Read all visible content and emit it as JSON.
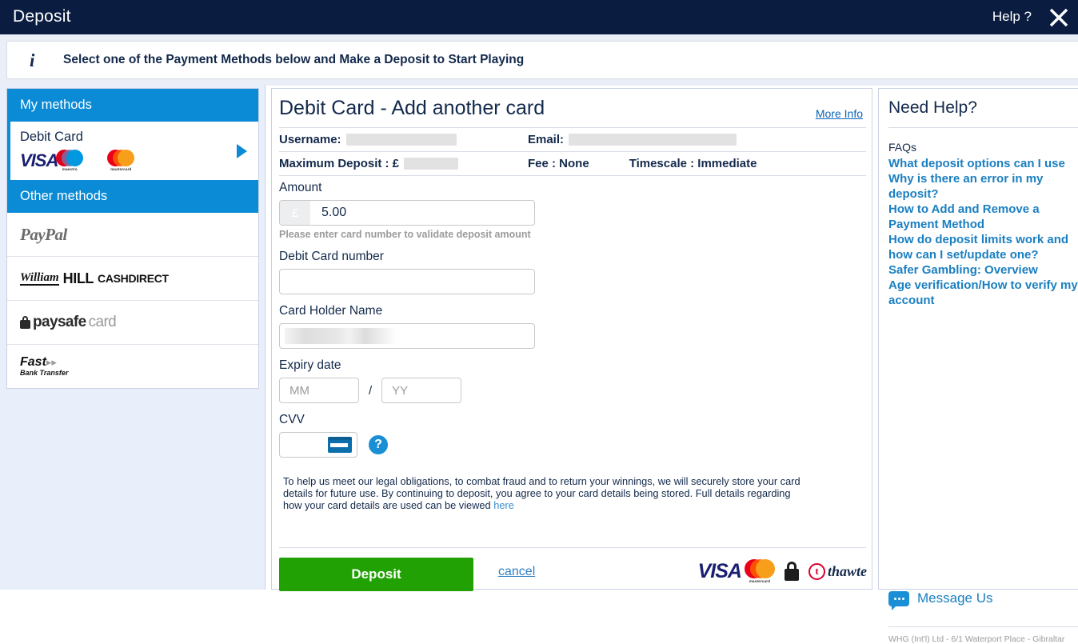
{
  "topbar": {
    "title": "Deposit",
    "help_label": "Help ?",
    "close_icon": "close-icon"
  },
  "banner": {
    "icon": "info-icon",
    "text": "Select one of the Payment Methods below and Make a Deposit to Start Playing"
  },
  "sidebar": {
    "my_methods_label": "My methods",
    "other_methods_label": "Other methods",
    "my_methods": [
      {
        "label": "Debit Card",
        "logos": [
          "visa-logo",
          "maestro-logo",
          "mastercard-logo"
        ],
        "selected": true,
        "arrow_icon": "chevron-right-icon"
      }
    ],
    "other_methods": [
      {
        "label": "PayPal",
        "logo": "paypal-logo"
      },
      {
        "label": "William Hill Cash Direct",
        "logo": "williamhill-cashdirect-logo"
      },
      {
        "label": "paysafecard",
        "logo": "paysafecard-logo"
      },
      {
        "label": "Fast Bank Transfer",
        "logo": "fast-bank-transfer-logo"
      }
    ]
  },
  "main": {
    "title": "Debit Card - Add another card",
    "more_info_label": "More Info",
    "username_label": "Username:",
    "email_label": "Email:",
    "max_deposit_label": "Maximum Deposit : £",
    "fee_label": "Fee : None",
    "timescale_label": "Timescale : Immediate",
    "amount_label": "Amount",
    "amount_currency": "£",
    "amount_value": "5.00",
    "amount_hint": "Please enter card number to validate deposit amount",
    "card_number_label": "Debit Card number",
    "card_number_value": "",
    "card_holder_label": "Card Holder Name",
    "card_holder_value": "",
    "expiry_label": "Expiry date",
    "expiry_month_placeholder": "MM",
    "expiry_separator": "/",
    "expiry_year_placeholder": "YY",
    "cvv_label": "CVV",
    "cvv_value": "",
    "cvv_card_icon": "credit-card-icon",
    "cvv_help_icon": "question-mark-icon",
    "legal_text": "To help us meet our legal obligations, to combat fraud and to return your winnings, we will securely store your card details for future use. By continuing to deposit, you agree to your card details being stored. Full details regarding how your card details are used can be viewed ",
    "legal_link_label": "here",
    "deposit_button_label": "Deposit",
    "cancel_label": "cancel",
    "trust_logos": [
      "visa-logo",
      "mastercard-logo",
      "padlock-icon",
      "thawte-logo"
    ],
    "thawte_label": "thawte"
  },
  "help": {
    "title": "Need Help?",
    "faqs_label": "FAQs",
    "faq_items": [
      "What deposit options can I use",
      "Why is there an error in my deposit?",
      "How to Add and Remove a Payment Method",
      "How do deposit limits work and how can I set/update one?",
      "Safer Gambling: Overview",
      "Age verification/How to verify my account"
    ],
    "message_us_label": "Message Us",
    "message_us_icon": "chat-bubble-icon",
    "footer_text": "WHG (Int'l) Ltd - 6/1 Waterport Place - Gibraltar"
  },
  "colors": {
    "topbar_bg": "#0a1c40",
    "accent_blue": "#0b8bd5",
    "link_blue": "#1a7fc1",
    "deposit_green": "#21a104",
    "sidebar_bg": "#e9eefb"
  }
}
